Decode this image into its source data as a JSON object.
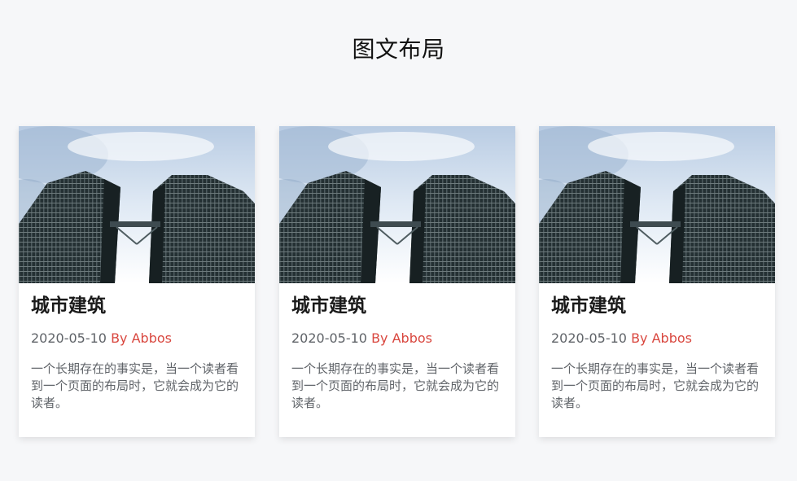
{
  "page": {
    "title": "图文布局"
  },
  "cards": [
    {
      "image_alt": "双子塔建筑",
      "title": "城市建筑",
      "date": "2020-05-10",
      "author": "By Abbos",
      "text": "一个长期存在的事实是，当一个读者看到一个页面的布局时，它就会成为它的读者。"
    },
    {
      "image_alt": "双子塔建筑",
      "title": "城市建筑",
      "date": "2020-05-10",
      "author": "By Abbos",
      "text": "一个长期存在的事实是，当一个读者看到一个页面的布局时，它就会成为它的读者。"
    },
    {
      "image_alt": "双子塔建筑",
      "title": "城市建筑",
      "date": "2020-05-10",
      "author": "By Abbos",
      "text": "一个长期存在的事实是，当一个读者看到一个页面的布局时，它就会成为它的读者。"
    }
  ],
  "colors": {
    "page_background": "#f6f7f9",
    "card_background": "#ffffff",
    "author_color": "#d9473f",
    "text_color": "#5f6368",
    "title_color": "#1a1a1a"
  }
}
